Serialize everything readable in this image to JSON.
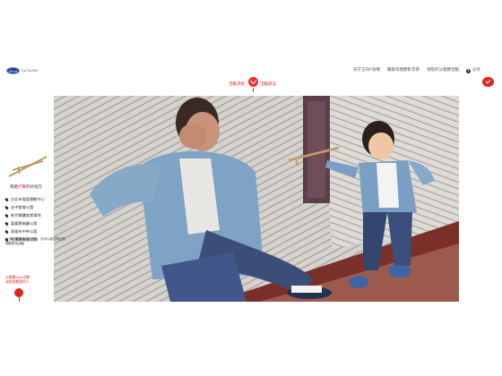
{
  "brand": {
    "logo_text": "Ford",
    "tagline": "Go Further"
  },
  "top_nav": {
    "items": [
      "孩子王DIY攻略",
      "獨家母親節影音帶",
      "領航的父親節活動"
    ],
    "share_label": "分享"
  },
  "center_nav": {
    "left_label": "活動流程",
    "right_label": "活動辦法"
  },
  "sidebar": {
    "title_before": "帶爸",
    "title_highlight": "打擊",
    "title_after": "的好地方",
    "locations": [
      "台北市福德運動中心",
      "台中都會公園",
      "新竹縣體育館場地",
      "嘉義縣美麗公園",
      "高雄市中央公園",
      "台東縣海濱公園"
    ],
    "note_lines": [
      "● 請先確認場地的資訊，也可以前往附近的",
      "  地點參加活動"
    ],
    "question_lines": [
      "父親節Ford活動",
      "送給我最愛的人"
    ]
  },
  "colors": {
    "accent": "#e3261c",
    "brand_blue": "#1c3f87"
  }
}
